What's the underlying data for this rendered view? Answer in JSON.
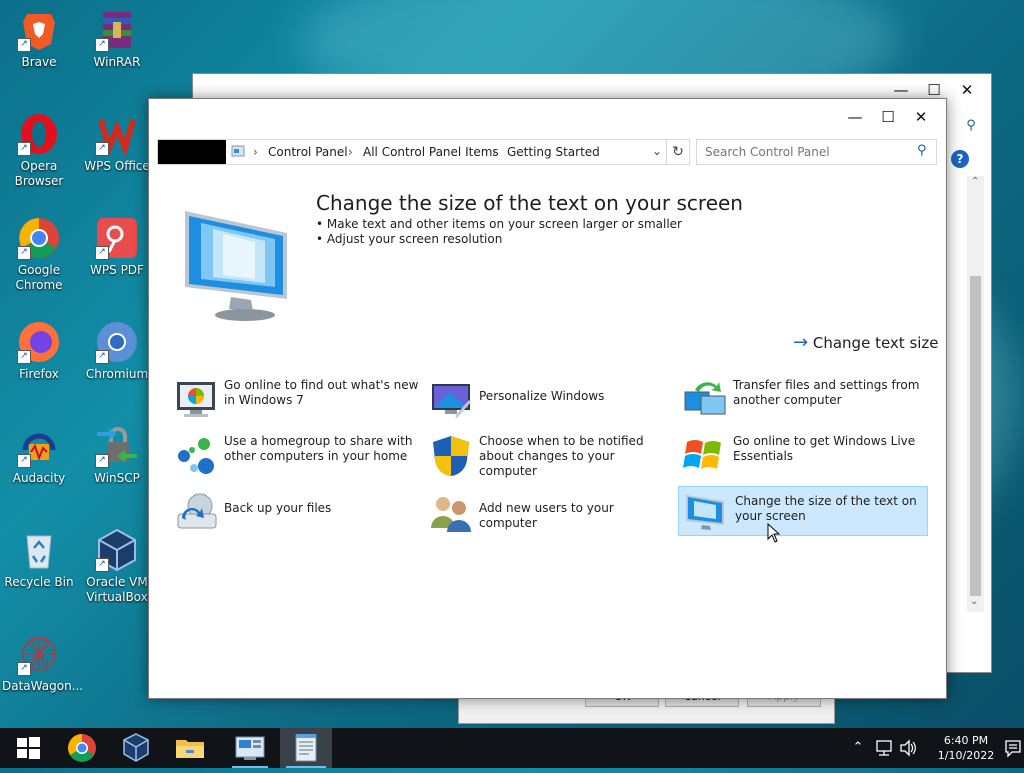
{
  "desktop": {
    "icons": [
      {
        "label": "Brave",
        "icon": "brave-icon"
      },
      {
        "label": "WinRAR",
        "icon": "winrar-icon"
      },
      {
        "label": "Opera Browser",
        "icon": "opera-icon"
      },
      {
        "label": "WPS Office",
        "icon": "wps-office-icon"
      },
      {
        "label": "Google Chrome",
        "icon": "chrome-icon"
      },
      {
        "label": "WPS PDF",
        "icon": "wps-pdf-icon"
      },
      {
        "label": "Firefox",
        "icon": "firefox-icon"
      },
      {
        "label": "Chromium",
        "icon": "chromium-icon"
      },
      {
        "label": "Audacity",
        "icon": "audacity-icon"
      },
      {
        "label": "WinSCP",
        "icon": "winscp-icon"
      },
      {
        "label": "Recycle Bin",
        "icon": "recycle-bin-icon"
      },
      {
        "label": "Oracle VM VirtualBox",
        "icon": "virtualbox-icon"
      },
      {
        "label": "DataWagon...",
        "icon": "datawagon-icon"
      }
    ]
  },
  "back_dialog": {
    "ok": "OK",
    "cancel": "Cancel",
    "apply": "Apply"
  },
  "window": {
    "breadcrumb": [
      "Control Panel",
      "All Control Panel Items",
      "Getting Started"
    ],
    "search_placeholder": "Search Control Panel",
    "hero": {
      "title": "Change the size of the text on your screen",
      "bullets": [
        "Make text and other items on your screen larger or smaller",
        "Adjust your screen resolution"
      ],
      "link": "Change text size"
    },
    "tasks": [
      {
        "label": "Go online to find out what's new in Windows 7",
        "icon": "whats-new-icon"
      },
      {
        "label": "Personalize Windows",
        "icon": "personalize-icon"
      },
      {
        "label": "Transfer files and settings from another computer",
        "icon": "transfer-icon"
      },
      {
        "label": "Use a homegroup to share with other computers in your home",
        "icon": "homegroup-icon"
      },
      {
        "label": "Choose when to be notified about changes to your computer",
        "icon": "uac-shield-icon"
      },
      {
        "label": "Go online to get Windows Live Essentials",
        "icon": "windows-live-icon"
      },
      {
        "label": "Back up your files",
        "icon": "backup-icon"
      },
      {
        "label": "Add new users to your computer",
        "icon": "users-icon"
      },
      {
        "label": "Change the size of the text on your screen",
        "icon": "display-icon"
      }
    ],
    "selected_task": "Change the size of the text on your screen"
  },
  "taskbar": {
    "time": "6:40 PM",
    "date": "1/10/2022",
    "apps": [
      "start-icon",
      "chrome-icon",
      "virtualbox-icon",
      "file-explorer-icon",
      "control-panel-icon",
      "notepad-icon"
    ]
  },
  "colors": {
    "accent": "#0078d7",
    "selection": "#cce8ff",
    "taskbar": "#101418"
  }
}
